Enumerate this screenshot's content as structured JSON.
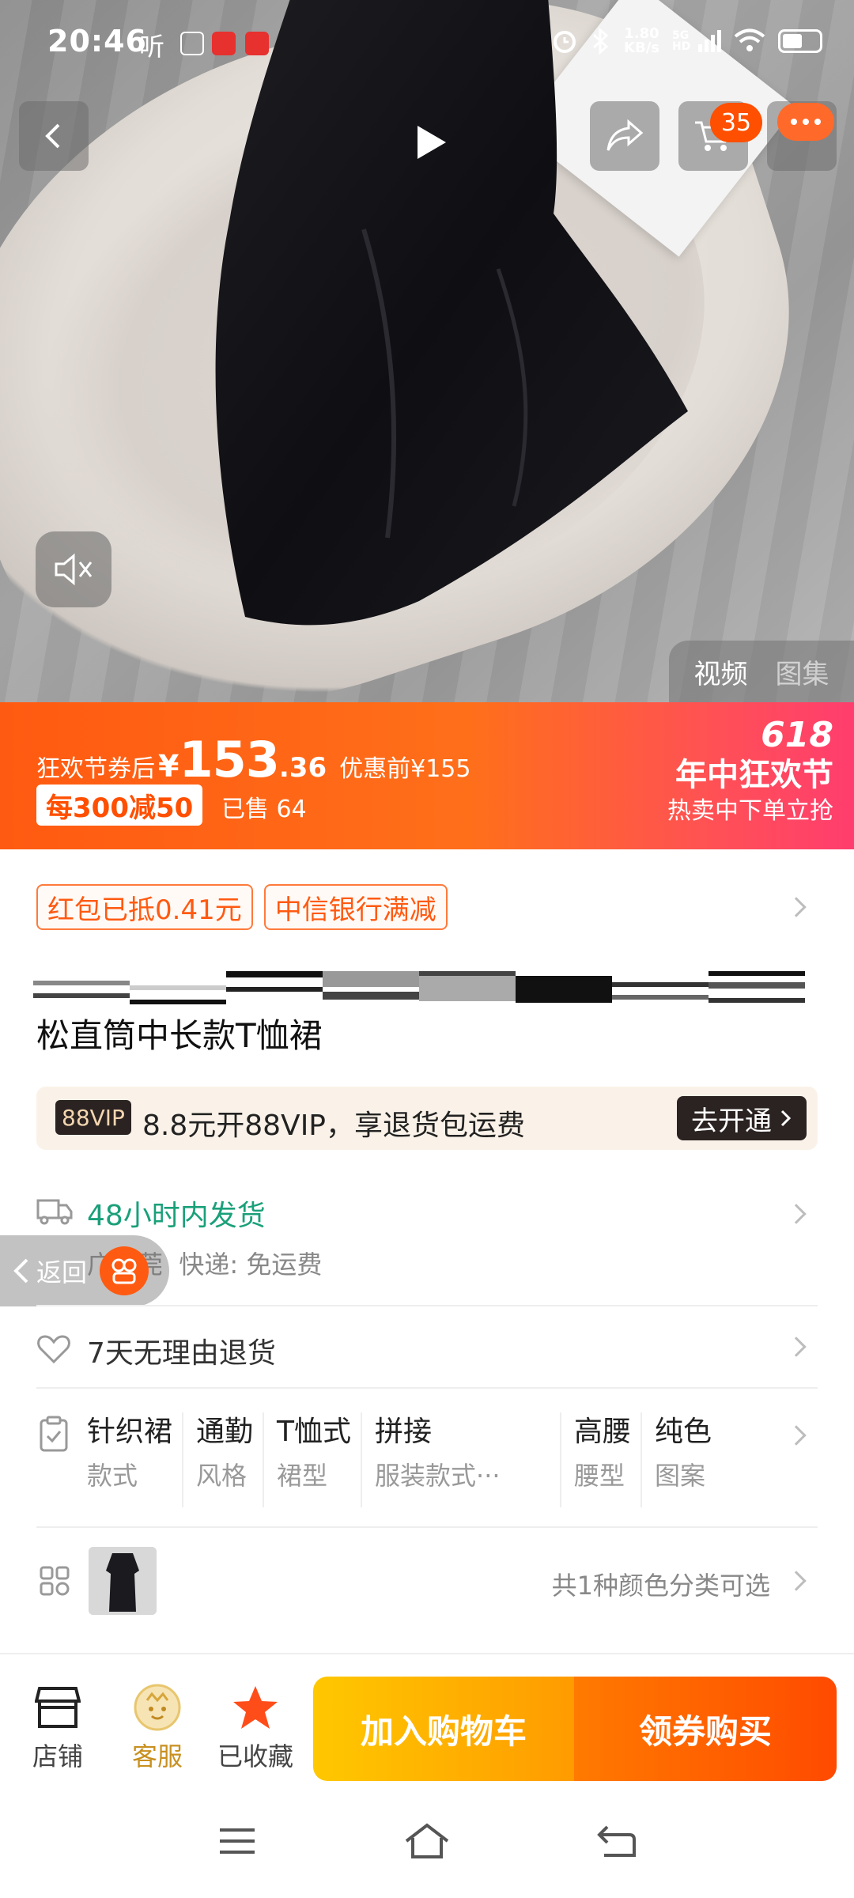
{
  "status_bar": {
    "time": "20:46",
    "extra": "听",
    "net_speed_value": "1.80",
    "net_speed_unit": "KB/s",
    "signal": "5G HD"
  },
  "header": {
    "cart_count": "35"
  },
  "media": {
    "tabs": [
      {
        "label": "视频",
        "active": true
      },
      {
        "label": "图集",
        "active": false
      }
    ]
  },
  "promo": {
    "label": "狂欢节券后",
    "yen": "¥",
    "price_int": "153",
    "price_dec": ".36",
    "original": "优惠前¥155",
    "discount_tag": "每300减50",
    "sold": "已售 64",
    "festival_618": "618",
    "festival_name": "年中狂欢节",
    "festival_sub": "热卖中下单立抢",
    "colors": {
      "start": "#ff5a11",
      "end": "#ff3d6e"
    }
  },
  "coupons": [
    {
      "label": "红包已抵0.41元"
    },
    {
      "label": "中信银行满减"
    }
  ],
  "product": {
    "title_line2": "松直筒中长款T恤裙"
  },
  "vip": {
    "logo": "88VIP",
    "text": "8.8元开88VIP，享退货包运费",
    "button": "去开通"
  },
  "shipping": {
    "title": "48小时内发货",
    "origin_prefix": "广",
    "origin_rest": "东莞",
    "express": "快递: 免运费",
    "accent": "#1aa07a"
  },
  "floating_back": {
    "label": "返回"
  },
  "returns": {
    "text": "7天无理由退货"
  },
  "attributes": [
    {
      "value": "针织裙",
      "key": "款式"
    },
    {
      "value": "通勤",
      "key": "风格"
    },
    {
      "value": "T恤式",
      "key": "裙型"
    },
    {
      "value": "拼接",
      "key": "服装款式···"
    },
    {
      "value": "高腰",
      "key": "腰型"
    },
    {
      "value": "纯色",
      "key": "图案"
    }
  ],
  "color_option": {
    "text": "共1种颜色分类可选"
  },
  "bottom_bar": {
    "store": "店铺",
    "service": "客服",
    "favorited": "已收藏",
    "add_to_cart": "加入购物车",
    "buy_now": "领券购买",
    "accent_star": "#ff4d1a"
  }
}
